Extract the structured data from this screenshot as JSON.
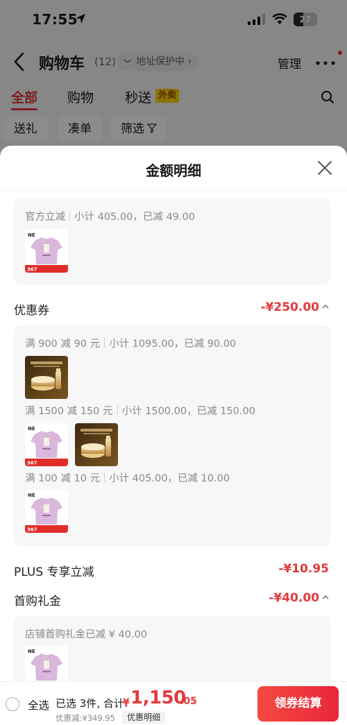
{
  "status_bar": {
    "time": "17:55",
    "battery": "27"
  },
  "nav": {
    "title": "购物车",
    "count": "(12)",
    "address_label": "地址保护中",
    "manage_label": "管理"
  },
  "tabs": [
    {
      "label": "全部"
    },
    {
      "label": "购物"
    },
    {
      "label": "秒送"
    }
  ],
  "tab_badge": "外卖",
  "chips": [
    {
      "label": "送礼"
    },
    {
      "label": "凑单"
    },
    {
      "label": "筛选"
    }
  ],
  "sheet": {
    "title": "金额明细",
    "official": {
      "name": "官方立减",
      "detail": "小计 405.00，已减 49.00"
    },
    "coupon": {
      "label": "优惠券",
      "amount": "-¥250.00",
      "groups": [
        {
          "name": "满 900 减 90 元",
          "detail": "小计 1095.00，已减 90.00"
        },
        {
          "name": "满 1500 减 150 元",
          "detail": "小计 1500.00，已减 150.00"
        },
        {
          "name": "满 100 减 10 元",
          "detail": "小计 405.00，已减 10.00"
        }
      ]
    },
    "plus": {
      "label": "PLUS 专享立减",
      "amount": "-¥10.95"
    },
    "first_gift": {
      "label": "首购礼金",
      "amount": "-¥40.00",
      "detail": "店铺首购礼金已减 ¥ 40.00"
    }
  },
  "product_badge": "367",
  "bottom": {
    "select_all": "全选",
    "selected_text": "已选 3件, 合计:",
    "currency": "¥",
    "total_int": "1,150",
    "total_dec": ".05",
    "discount_text": "优惠减:¥349.95",
    "detail_tag": "优惠明细",
    "checkout": "领券结算"
  },
  "colors": {
    "accent": "#e4393c",
    "waimai_bg": "#ffd400",
    "tshirt": "#d9b8dc"
  },
  "icons": [
    "location-arrow-icon",
    "signal-icon",
    "wifi-icon",
    "battery-icon",
    "back-icon",
    "shield-icon",
    "chevron-right-icon",
    "more-icon",
    "search-icon",
    "filter-icon",
    "close-icon",
    "chevron-up-icon",
    "radio-icon"
  ]
}
